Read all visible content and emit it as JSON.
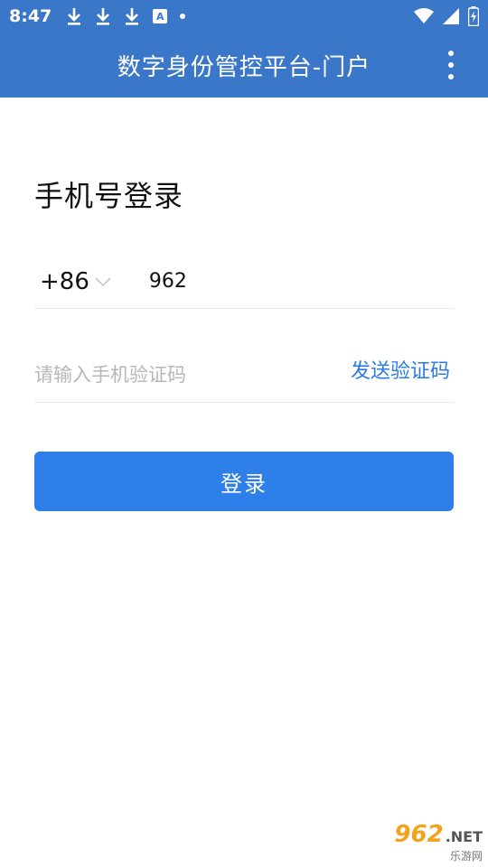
{
  "status_bar": {
    "time": "8:47",
    "icons": [
      "download-icon",
      "download-icon",
      "download-icon",
      "a-icon",
      "dot-icon"
    ],
    "right_icons": [
      "wifi-icon",
      "signal-icon",
      "battery-icon"
    ]
  },
  "app_bar": {
    "title": "数字身份管控平台-门户",
    "menu_icon": "more-vertical-icon"
  },
  "login": {
    "title": "手机号登录",
    "country_code": "+86",
    "phone_value": "962",
    "code_placeholder": "请输入手机验证码",
    "send_code_label": "发送验证码",
    "submit_label": "登录"
  },
  "watermark": {
    "num": "962",
    "net": ".NET",
    "sub": "乐游网"
  },
  "colors": {
    "header": "#3a77c8",
    "primary_button": "#2f7fea",
    "link": "#2c7be5"
  }
}
